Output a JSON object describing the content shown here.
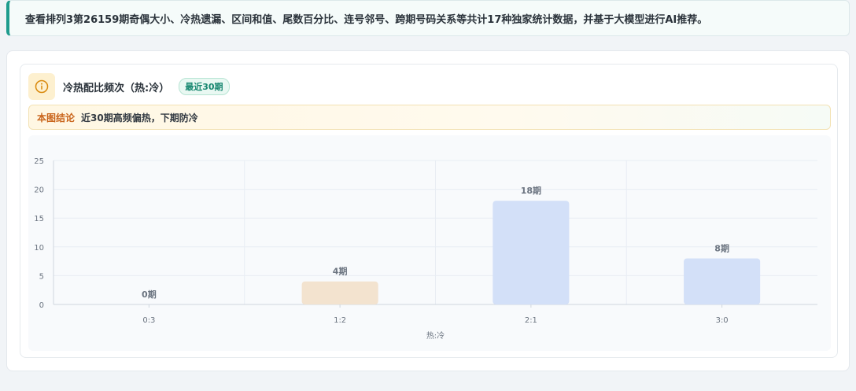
{
  "banner": {
    "text": "查看排列3第26159期奇偶大小、冷热遗漏、区间和值、尾数百分比、连号邻号、跨期号码关系等共计17种独家统计数据，并基于大模型进行AI推荐。"
  },
  "card": {
    "icon": "info-icon",
    "title": "冷热配比频次（热:冷）",
    "badge": "最近30期",
    "conclusion_label": "本图结论",
    "conclusion_text": "近30期高频偏热，下期防冷"
  },
  "colors": {
    "accent": "#1f9c8e",
    "bar_default": "#d3e0f8",
    "bar_highlight": "#f3e3cf"
  },
  "chart_data": {
    "type": "bar",
    "categories": [
      "0:3",
      "1:2",
      "2:1",
      "3:0"
    ],
    "values": [
      0,
      4,
      18,
      8
    ],
    "data_labels": [
      "0期",
      "4期",
      "18期",
      "8期"
    ],
    "highlight_index": 1,
    "xlabel": "热:冷",
    "ylabel": "",
    "ylim": [
      0,
      25
    ],
    "yticks": [
      "0",
      "5",
      "10",
      "15",
      "20",
      "25"
    ],
    "grid": true
  }
}
